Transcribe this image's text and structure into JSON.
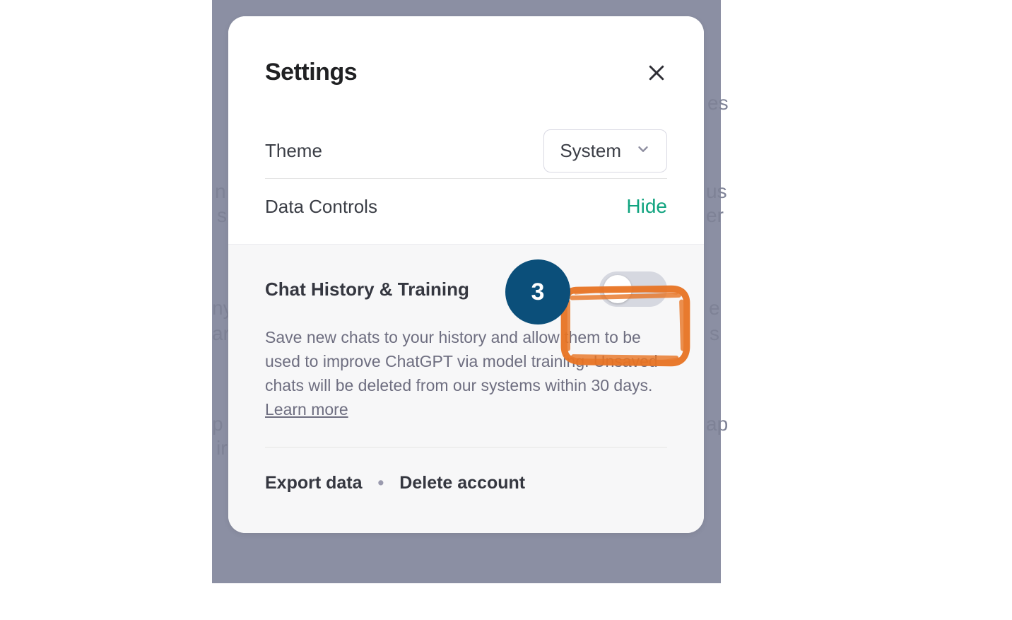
{
  "modal": {
    "title": "Settings",
    "theme": {
      "label": "Theme",
      "value": "System"
    },
    "dataControls": {
      "label": "Data Controls",
      "toggleLink": "Hide",
      "chatHistory": {
        "title": "Chat History & Training",
        "toggle_on": false,
        "description_prefix": "Save new chats to your history and allow them to be used to improve ChatGPT via model training. Unsaved chats will be deleted from our systems within 30 days. ",
        "learn_more": "Learn more"
      },
      "export": "Export data",
      "delete": "Delete account"
    }
  },
  "annotation": {
    "step_number": "3",
    "highlight_color": "#e87424",
    "badge_color": "#0b4f7a"
  },
  "backdrop_fragments": {
    "a": "es",
    "b": "us",
    "c": "er",
    "d": "e",
    "e": "s",
    "f": "ap",
    "g": "n",
    "h": "s",
    "i": "ny",
    "j": "ar",
    "k": "p I",
    "l": "ir"
  }
}
